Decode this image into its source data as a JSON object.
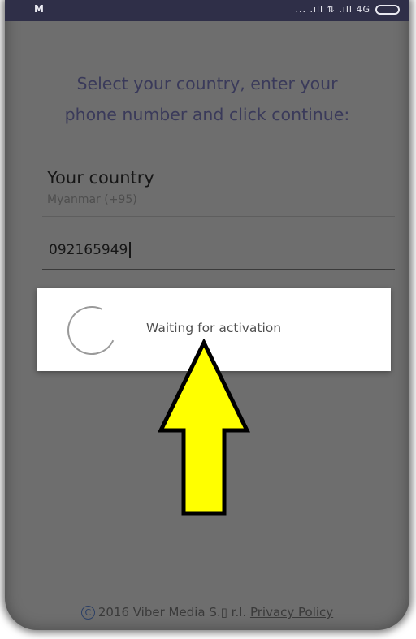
{
  "statusbar": {
    "carrier": "M",
    "signals": "... .ıll ⇅ .ıll 4G"
  },
  "registration": {
    "instructions_line1": "Select your country, enter your",
    "instructions_line2": "phone number and click continue:",
    "country_heading": "Your country",
    "country_value": "Myanmar (+95)",
    "phone_number": "092165949"
  },
  "dialog": {
    "message": "Waiting for activation"
  },
  "annotation": {
    "arrow_color": "#ffff00",
    "arrow_icon": "up-arrow-icon"
  },
  "footer": {
    "copyright_symbol": "C",
    "copyright_text": "2016 Viber Media S.▯ r.l.",
    "privacy_link": "Privacy Policy"
  }
}
